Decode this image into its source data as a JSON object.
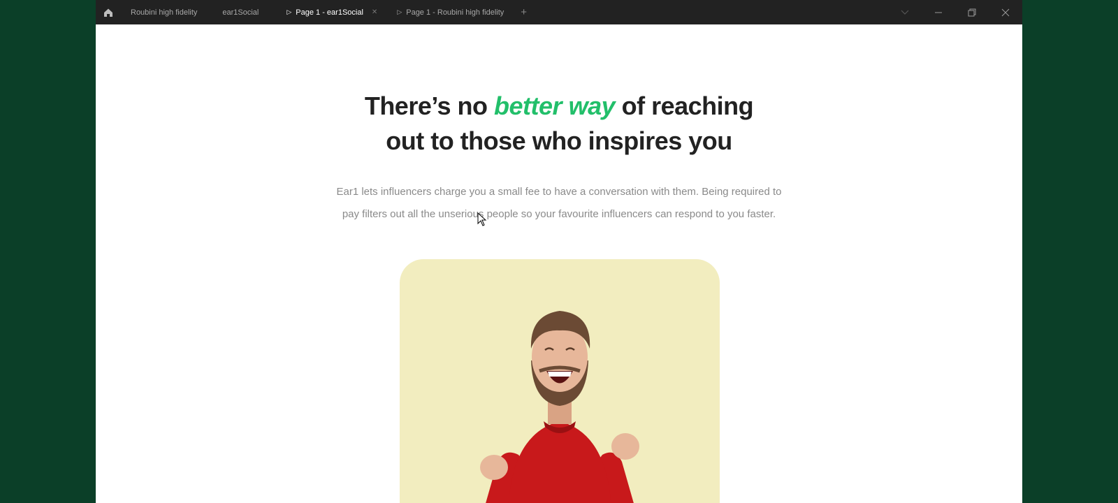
{
  "tabs": [
    {
      "label": "Roubini high fidelity",
      "active": false,
      "play": false
    },
    {
      "label": "ear1Social",
      "active": false,
      "play": false
    },
    {
      "label": "Page 1 - ear1Social",
      "active": true,
      "play": true
    },
    {
      "label": "Page 1 - Roubini high fidelity",
      "active": false,
      "play": true
    }
  ],
  "icons": [
    "home-icon",
    "play-icon",
    "close-icon",
    "plus-icon",
    "chevron-down-icon",
    "minimize-icon",
    "restore-icon",
    "window-close-icon",
    "cursor-icon"
  ],
  "hero": {
    "headline_pre": "There’s no ",
    "headline_highlight": "better way",
    "headline_post": " of reaching",
    "headline_line2": "out to those who inspires you",
    "subtext_line1": "Ear1 lets influencers charge you a small fee to have a conversation with them. Being required to",
    "subtext_line2": "pay filters out all the unserious people so your favourite influencers can respond to you faster."
  },
  "colors": {
    "desktop": "#0b3f28",
    "titlebar": "#222222",
    "accent": "#22bf6a",
    "headline": "#222222",
    "subtext": "#8a8a8a",
    "card": "#f2edbf",
    "sweater": "#c8191b"
  }
}
